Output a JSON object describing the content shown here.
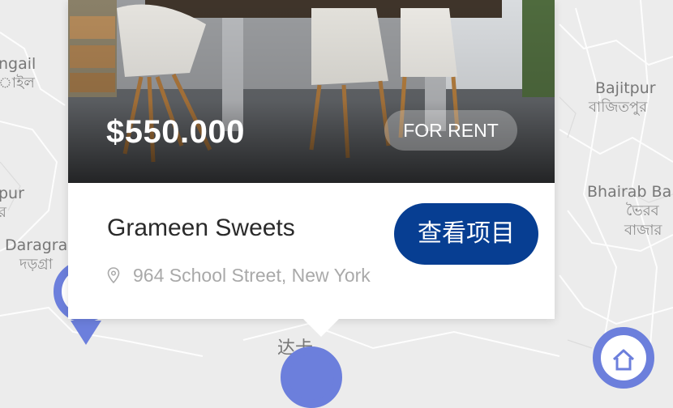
{
  "map": {
    "places": [
      {
        "name": "ngail",
        "sub": "াইল"
      },
      {
        "name": "pur",
        "sub": "র"
      },
      {
        "name": "Daragra",
        "sub": "দড়গ্রা"
      },
      {
        "name": "Bajitpur",
        "sub": "বাজিতপুর"
      },
      {
        "name": "Bhairab Ba",
        "sub": "ভৈরব"
      },
      {
        "name": "বাজার",
        "sub": ""
      },
      {
        "name": "达卡",
        "sub": ""
      }
    ],
    "pin_color": "#6c7fdc",
    "icons": [
      "home-icon"
    ]
  },
  "listing": {
    "price": "$550.000",
    "badge": "FOR RENT",
    "title": "Grameen Sweets",
    "address": "964 School Street, New York",
    "button_label": "查看项目",
    "button_color": "#073e92",
    "icons": [
      "location-pin-icon"
    ]
  }
}
